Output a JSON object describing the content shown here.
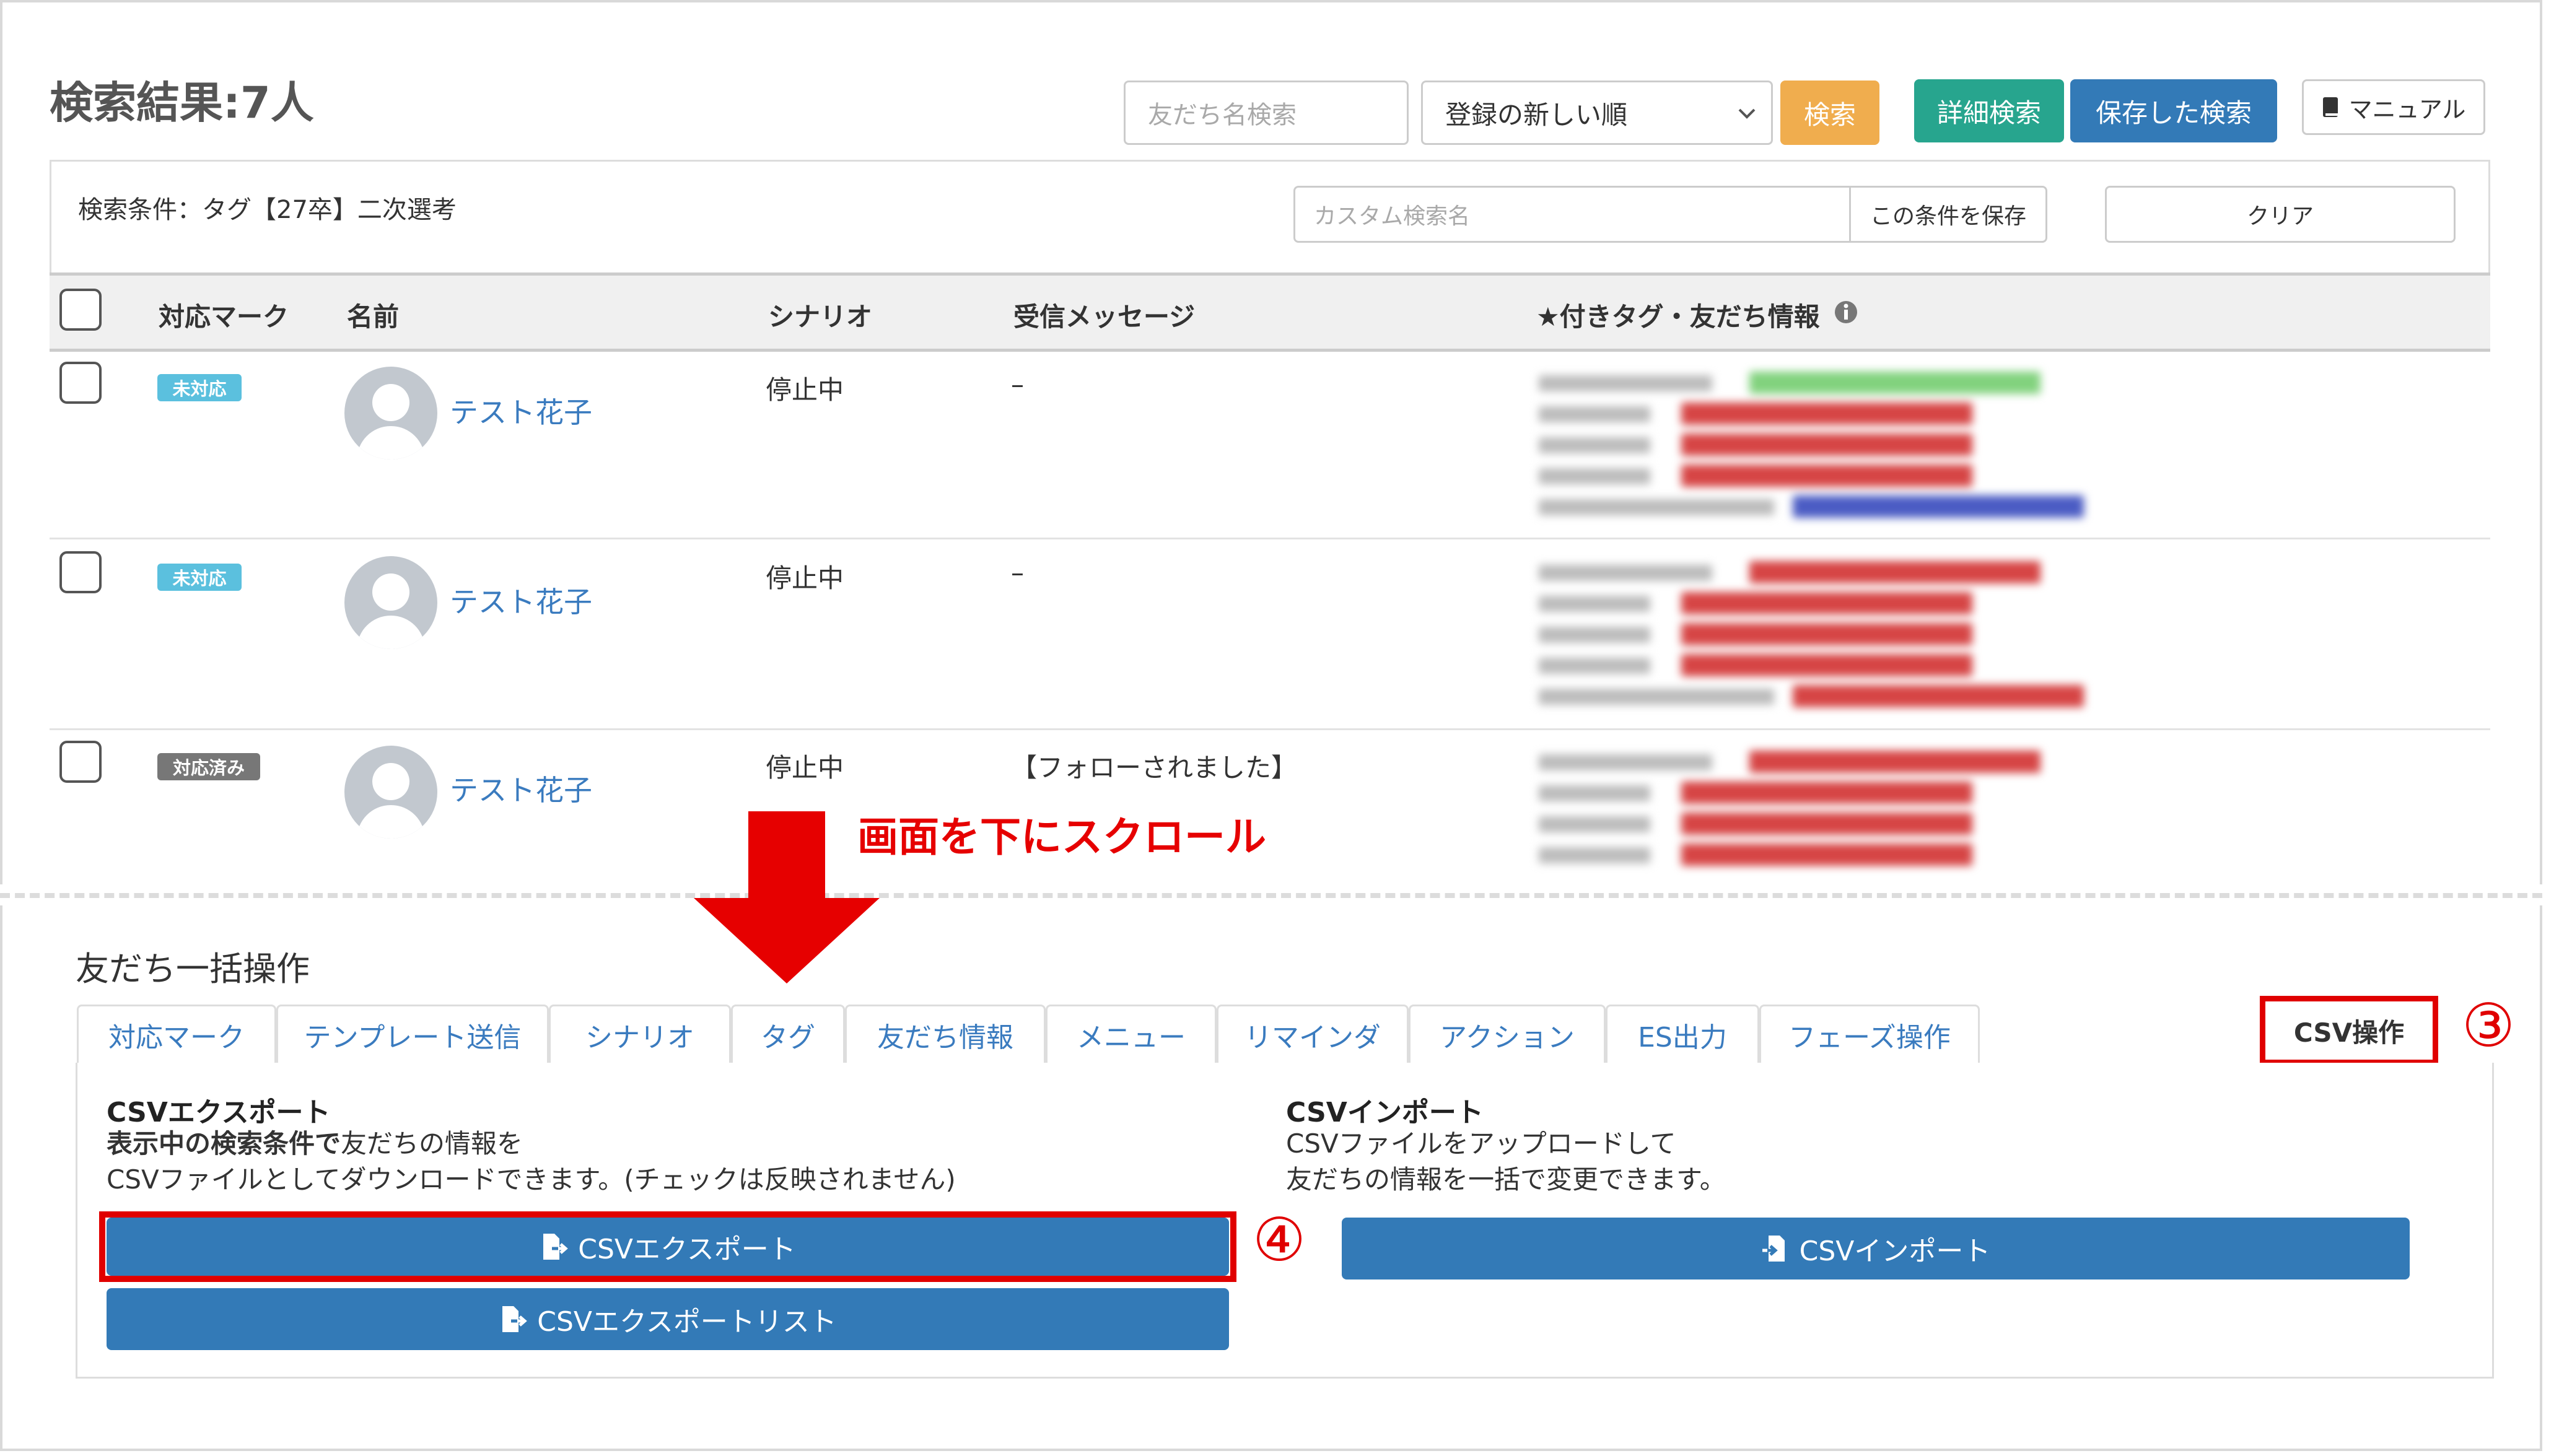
{
  "header": {
    "title": "検索結果:7人",
    "search_placeholder": "友だち名検索",
    "sort_selected": "登録の新しい順",
    "search_btn": "検索",
    "detail_search_btn": "詳細検索",
    "saved_search_btn": "保存した検索",
    "manual_btn": "マニュアル"
  },
  "conditions": {
    "label": "検索条件：タグ【27卒】二次選考",
    "custom_name_placeholder": "カスタム検索名",
    "save_condition_btn": "この条件を保存",
    "clear_btn": "クリア"
  },
  "table": {
    "columns": [
      "対応マーク",
      "名前",
      "シナリオ",
      "受信メッセージ",
      "★付きタグ・友だち情報"
    ],
    "rows": [
      {
        "badge": "未対応",
        "name": "テスト花子",
        "scenario": "停止中",
        "message": "–"
      },
      {
        "badge": "未対応",
        "name": "テスト花子",
        "scenario": "停止中",
        "message": "–"
      },
      {
        "badge": "対応済み",
        "name": "テスト花子",
        "scenario": "停止中",
        "message": "【フォローされました】"
      }
    ]
  },
  "annotation": {
    "scroll_text": "画面を下にスクロール",
    "step3": "③",
    "step4": "④"
  },
  "bulk": {
    "title": "友だち一括操作",
    "tabs": [
      "対応マーク",
      "テンプレート送信",
      "シナリオ",
      "タグ",
      "友だち情報",
      "メニュー",
      "リマインダ",
      "アクション",
      "ES出力",
      "フェーズ操作"
    ],
    "active_tab": "CSV操作",
    "export": {
      "title": "CSVエクスポート",
      "desc_bold": "表示中の検索条件で",
      "desc_rest": "友だちの情報を",
      "desc_line2": "CSVファイルとしてダウンロードできます。(チェックは反映されません)",
      "btn": "CSVエクスポート",
      "list_btn": "CSVエクスポートリスト"
    },
    "import": {
      "title": "CSVインポート",
      "desc_line1": "CSVファイルをアップロードして",
      "desc_line2": "友だちの情報を一括で変更できます。",
      "btn": "CSVインポート"
    }
  },
  "colors": {
    "primary": "#337ab7",
    "teal": "#27a58e",
    "orange": "#f0ad4e",
    "badge_unhandled": "#5bc0de",
    "badge_done": "#777777",
    "highlight_red": "#e00000",
    "link": "#3a7bbf"
  },
  "icons": [
    "chevron-down-icon",
    "book-icon",
    "info-icon",
    "file-export-icon",
    "file-import-icon",
    "down-arrow-icon",
    "user-avatar-icon"
  ]
}
